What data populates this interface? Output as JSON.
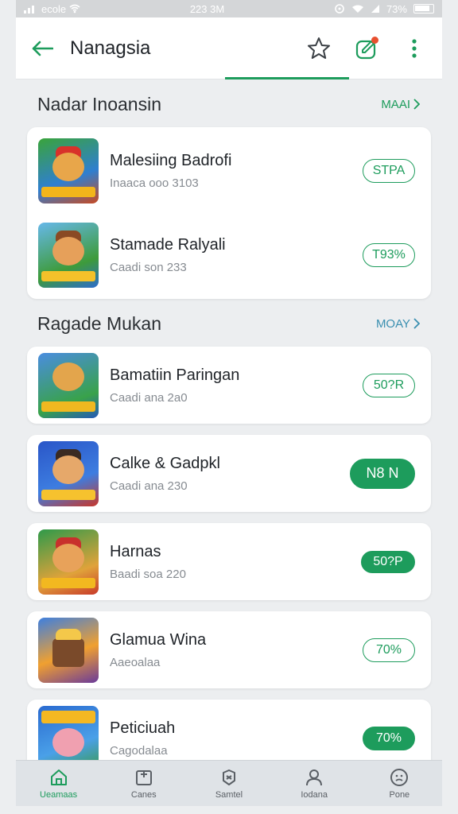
{
  "status_bar": {
    "carrier": "ecole",
    "time": "223 3M",
    "battery": "73%"
  },
  "app_bar": {
    "title": "Nanagsia",
    "back_icon": "back-arrow-icon",
    "star_icon": "star-icon",
    "edit_icon": "edit-icon",
    "menu_icon": "more-vert-icon"
  },
  "colors": {
    "accent": "#1d9c5c",
    "badge": "#e8502f"
  },
  "sections": [
    {
      "title": "Nadar Inoansin",
      "link": "MAAI",
      "items": [
        {
          "name": "Malesiing Badrofi",
          "sub": "Inaaca ooo 3103",
          "action": "STPA"
        },
        {
          "name": "Stamade Ralyali",
          "sub": "Caadi son 233",
          "action": "T93%"
        }
      ]
    },
    {
      "title": "Ragade Mukan",
      "link": "MOAY",
      "items": [
        {
          "name": "Bamatiin Paringan",
          "sub": "Caadi ana 2a0",
          "action": "50?R"
        },
        {
          "name": "Calke & Gadpkl",
          "sub": "Caadi ana 230",
          "action": "N8 N"
        },
        {
          "name": "Harnas",
          "sub": "Baadi soa 220",
          "action": "50?P"
        },
        {
          "name": "Glamua Wina",
          "sub": "Aaeoalaa",
          "action": "70%"
        },
        {
          "name": "Peticiuah",
          "sub": "Cagodalaa",
          "action": "70%"
        }
      ]
    }
  ],
  "bottom_nav": [
    {
      "label": "Ueamaas",
      "icon": "home-icon"
    },
    {
      "label": "Canes",
      "icon": "games-icon"
    },
    {
      "label": "Samtel",
      "icon": "apps-icon"
    },
    {
      "label": "Iodana",
      "icon": "user-icon"
    },
    {
      "label": "Pone",
      "icon": "smiley-icon"
    }
  ]
}
